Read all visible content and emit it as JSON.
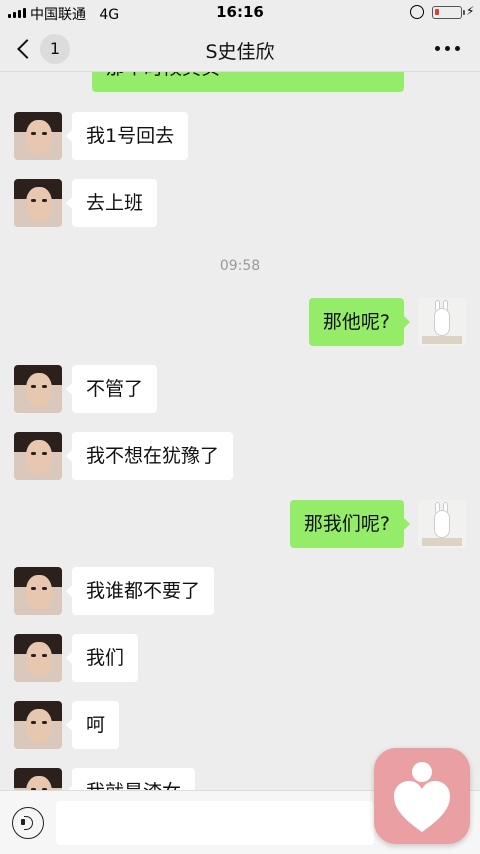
{
  "status_bar": {
    "carrier": "中国联通",
    "network": "4G",
    "time": "16:16"
  },
  "nav": {
    "back_count": "1",
    "title": "S史佳欣"
  },
  "chat": {
    "partial_top_text": "那个时候其实",
    "timestamp": "09:58",
    "messages": [
      {
        "side": "in",
        "text": "我1号回去"
      },
      {
        "side": "in",
        "text": "去上班"
      },
      {
        "side": "out",
        "text": "那他呢?"
      },
      {
        "side": "in",
        "text": "不管了"
      },
      {
        "side": "in",
        "text": "我不想在犹豫了"
      },
      {
        "side": "out",
        "text": "那我们呢?"
      },
      {
        "side": "in",
        "text": "我谁都不要了"
      },
      {
        "side": "in",
        "text": "我们"
      },
      {
        "side": "in",
        "text": "呵"
      },
      {
        "side": "in",
        "text": "我就是渣女"
      }
    ]
  },
  "input": {
    "placeholder": ""
  },
  "colors": {
    "background": "#ededed",
    "incoming_bubble": "#ffffff",
    "outgoing_bubble": "#95ec69",
    "floating_app": "#eaa0a2"
  }
}
